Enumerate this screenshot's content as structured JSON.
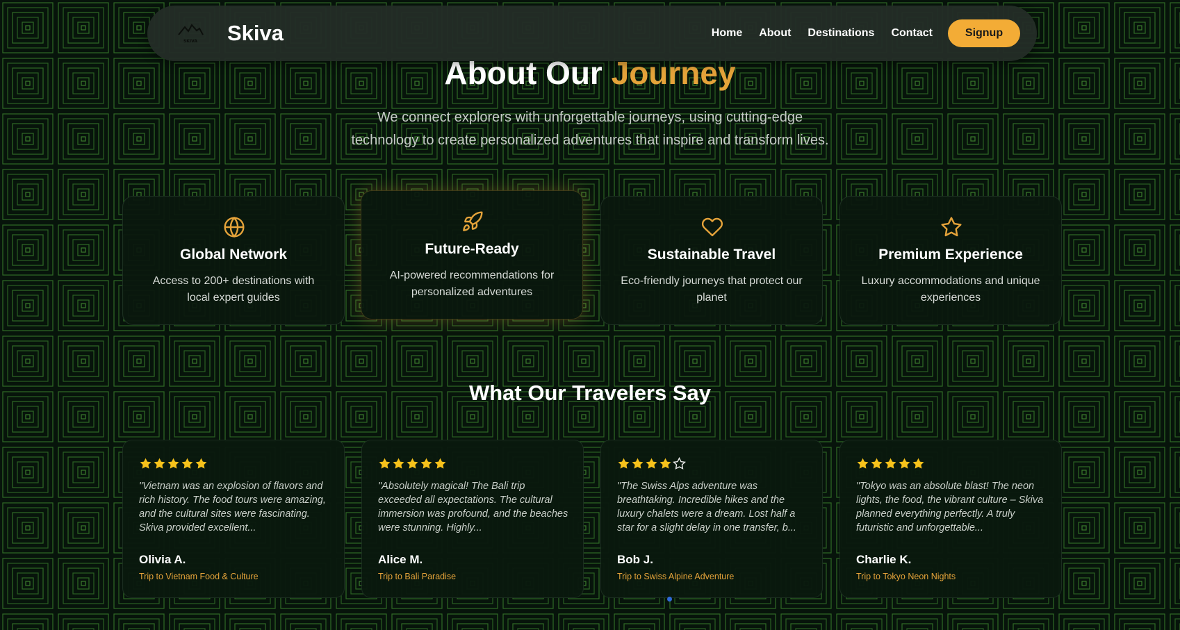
{
  "colors": {
    "accent": "#e5a33a",
    "signup_bg": "#f3ac36",
    "star": "#f7c21b",
    "background": "#07140b"
  },
  "nav": {
    "brand": "Skiva",
    "logo_text": "SKIVA",
    "links": [
      "Home",
      "About",
      "Destinations",
      "Contact"
    ],
    "signup": "Signup"
  },
  "about": {
    "title_part1": "About Our",
    "title_part2": "Journey",
    "subtitle_line1": "We connect explorers with unforgettable journeys, using cutting-edge",
    "subtitle_line2": "technology to create personalized adventures that inspire and transform lives."
  },
  "features": [
    {
      "icon": "globe-icon",
      "title": "Global Network",
      "desc": "Access to 200+ destinations with local expert guides"
    },
    {
      "icon": "rocket-icon",
      "title": "Future-Ready",
      "desc": "AI-powered recommendations for personalized adventures"
    },
    {
      "icon": "heart-icon",
      "title": "Sustainable Travel",
      "desc": "Eco-friendly journeys that protect our planet"
    },
    {
      "icon": "star-icon",
      "title": "Premium Experience",
      "desc": "Luxury accommodations and unique experiences"
    }
  ],
  "testimonials": {
    "title": "What Our Travelers Say",
    "items": [
      {
        "rating": 5,
        "quote": "\"Vietnam was an explosion of flavors and rich history. The food tours were amazing, and the cultural sites were fascinating. Skiva provided excellent...",
        "name": "Olivia A.",
        "trip": "Trip to Vietnam Food & Culture"
      },
      {
        "rating": 5,
        "quote": "\"Absolutely magical! The Bali trip exceeded all expectations. The cultural immersion was profound, and the beaches were stunning. Highly...",
        "name": "Alice M.",
        "trip": "Trip to Bali Paradise"
      },
      {
        "rating": 4,
        "quote": "\"The Swiss Alps adventure was breathtaking. Incredible hikes and the luxury chalets were a dream. Lost half a star for a slight delay in one transfer, b...",
        "name": "Bob J.",
        "trip": "Trip to Swiss Alpine Adventure"
      },
      {
        "rating": 5,
        "quote": "\"Tokyo was an absolute blast! The neon lights, the food, the vibrant culture – Skiva planned everything perfectly. A truly futuristic and unforgettable...",
        "name": "Charlie K.",
        "trip": "Trip to Tokyo Neon Nights"
      }
    ]
  }
}
